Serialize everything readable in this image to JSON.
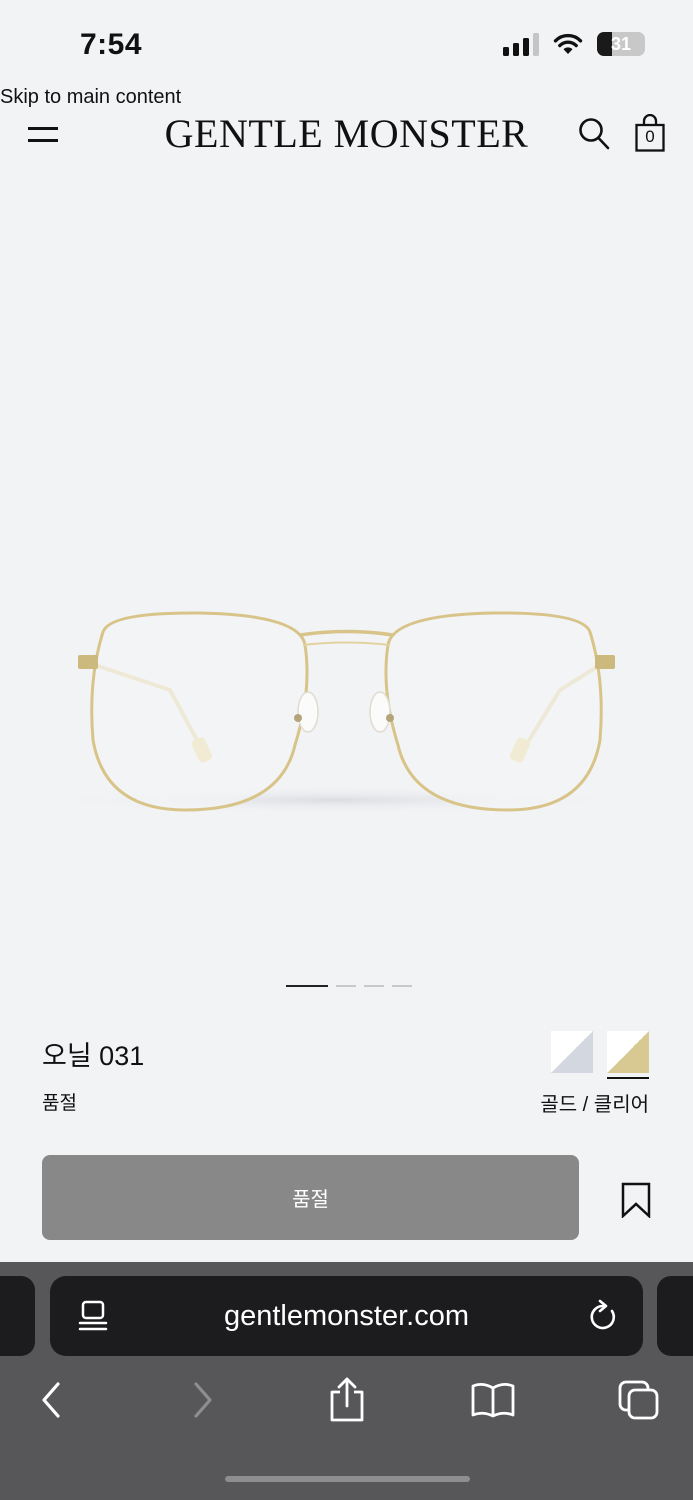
{
  "status_bar": {
    "time": "7:54",
    "battery_percent": 31,
    "battery_label": "31"
  },
  "skip_link": "Skip to main content",
  "header": {
    "logo": "GENTLE MONSTER",
    "cart_count": "0"
  },
  "carousel": {
    "slide_count": 4,
    "active_slide": 1
  },
  "product": {
    "name": "오닐 031",
    "status": "품절",
    "color_label": "골드 / 클리어",
    "swatches": [
      {
        "name": "silver-clear",
        "color_a": "#d3d8e0",
        "color_b": "#ffffff",
        "selected": false
      },
      {
        "name": "gold-clear",
        "color_a": "#d8c891",
        "color_b": "#ffffff",
        "selected": true
      }
    ],
    "button_label": "품절"
  },
  "browser": {
    "url": "gentlemonster.com"
  },
  "colors": {
    "page_bg": "#f2f3f5",
    "button_bg": "#888888",
    "browser_bg": "#575759",
    "address_bar_bg": "#1c1c1e"
  }
}
